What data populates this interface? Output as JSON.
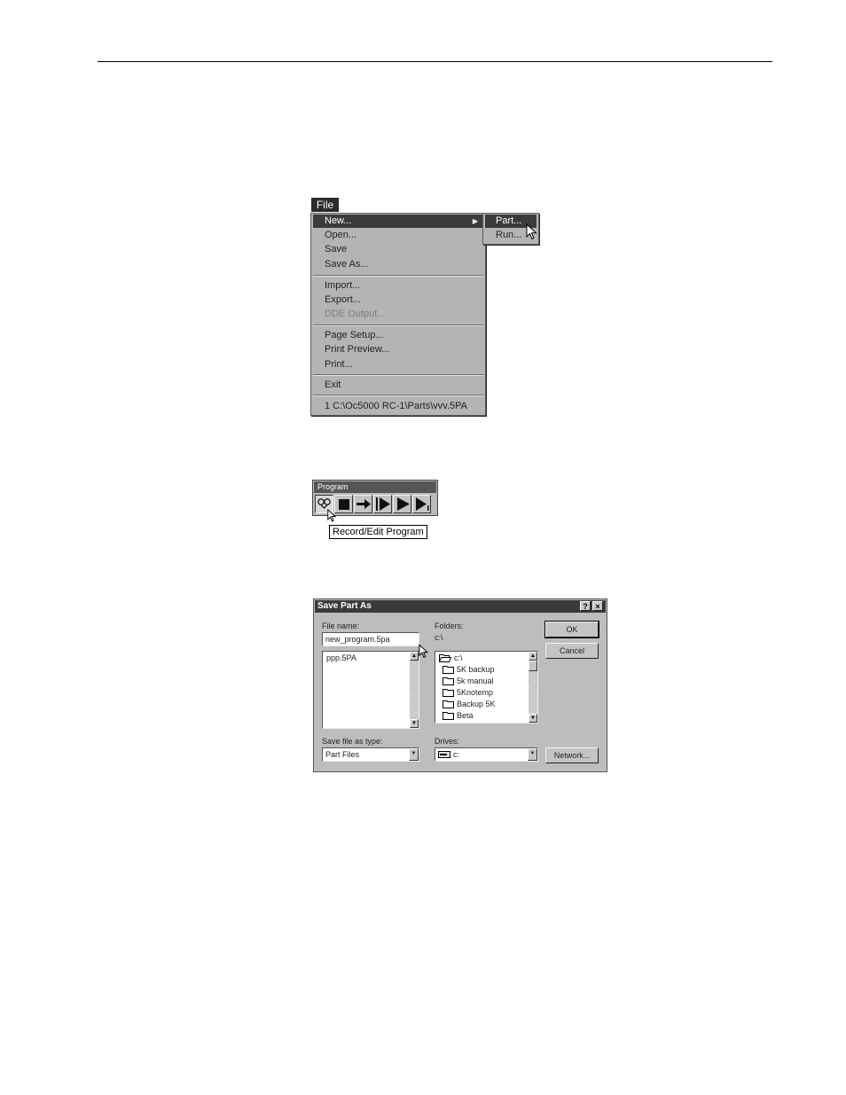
{
  "file_menu": {
    "bar_label": "File",
    "items": [
      {
        "label": "New..."
      },
      {
        "label": "Open..."
      },
      {
        "label": "Save"
      },
      {
        "label": "Save As..."
      },
      {
        "label": "Import..."
      },
      {
        "label": "Export..."
      },
      {
        "label": "DDE Output..."
      },
      {
        "label": "Page Setup..."
      },
      {
        "label": "Print Preview..."
      },
      {
        "label": "Print..."
      },
      {
        "label": "Exit"
      },
      {
        "label": "1  C:\\Oc5000 RC-1\\Parts\\vvv.5PA"
      }
    ],
    "submenu": [
      {
        "label": "Part..."
      },
      {
        "label": "Run..."
      }
    ]
  },
  "toolbar": {
    "title": "Program",
    "tooltip": "Record/Edit Program",
    "buttons": [
      {
        "icon": "record-edit-icon"
      },
      {
        "icon": "stop-icon"
      },
      {
        "icon": "step-arrow-icon"
      },
      {
        "icon": "run-from-line-icon"
      },
      {
        "icon": "run-icon"
      },
      {
        "icon": "run-single-icon"
      }
    ]
  },
  "dialog": {
    "title": "Save Part As",
    "help_btn": "?",
    "close_btn": "×",
    "file_name_label": "File name:",
    "file_name_value": "new_program.5pa",
    "files": [
      "ppp.5PA"
    ],
    "folders_label": "Folders:",
    "current_path": "c:\\",
    "folders": [
      "c:\\",
      "5K backup",
      "5k manual",
      "5Knotemp",
      "Backup 5K",
      "Beta"
    ],
    "save_type_label": "Save file as type:",
    "save_type_value": "Part Files",
    "drives_label": "Drives:",
    "drive_value": "c:",
    "ok_label": "OK",
    "cancel_label": "Cancel",
    "network_label": "Network..."
  }
}
